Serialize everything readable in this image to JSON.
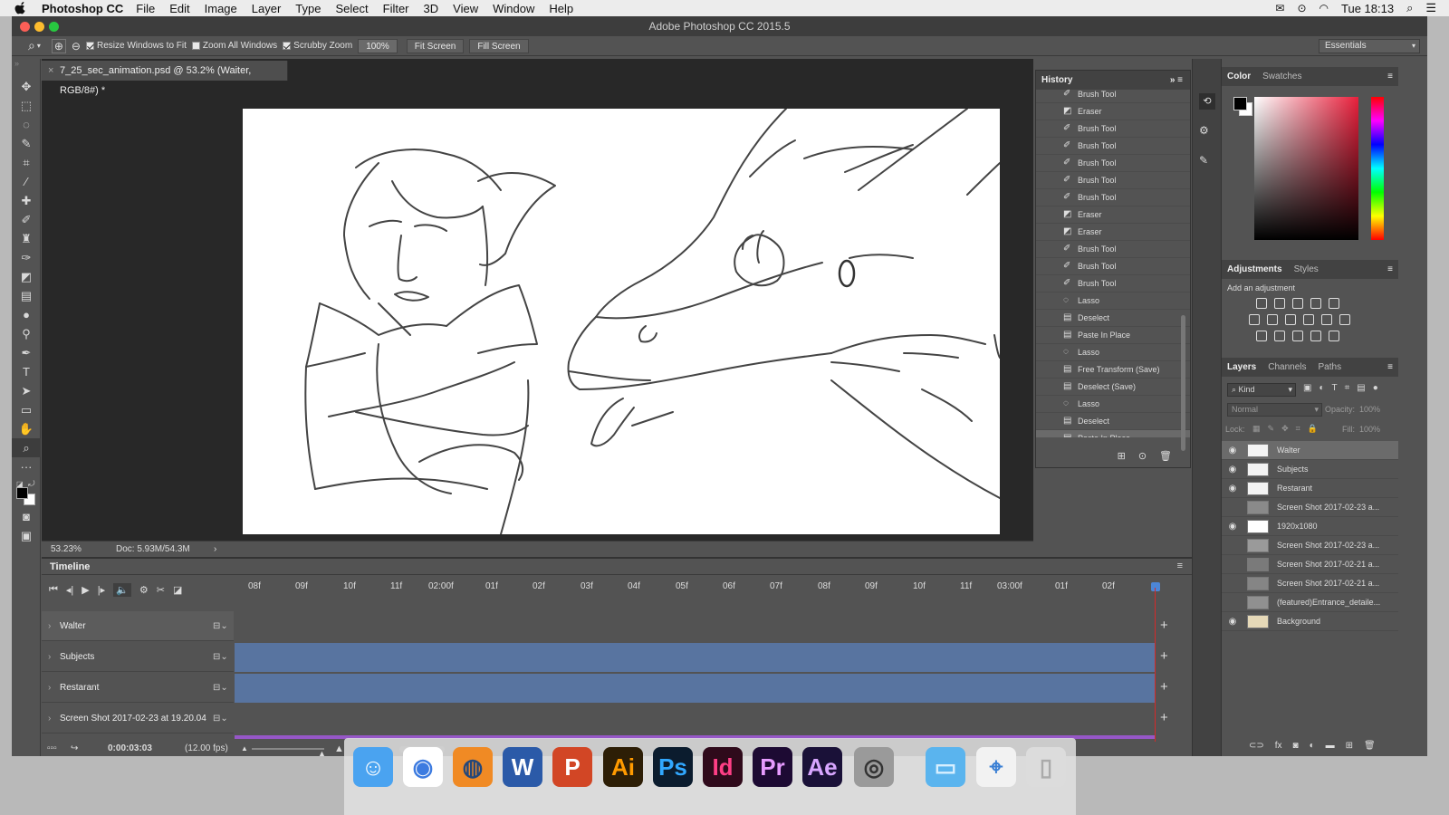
{
  "menubar": {
    "app_name": "Photoshop CC",
    "items": [
      "File",
      "Edit",
      "Image",
      "Layer",
      "Type",
      "Select",
      "Filter",
      "3D",
      "View",
      "Window",
      "Help"
    ],
    "clock": "Tue 18:13"
  },
  "window": {
    "title": "Adobe Photoshop CC 2015.5"
  },
  "options_bar": {
    "resize_windows": "Resize Windows to Fit",
    "zoom_all": "Zoom All Windows",
    "scrubby": "Scrubby Zoom",
    "zoom_value": "100%",
    "fit_screen": "Fit Screen",
    "fill_screen": "Fill Screen",
    "workspace": "Essentials"
  },
  "document": {
    "tab_title": "7_25_sec_animation.psd @ 53.2% (Waiter, RGB/8#) *",
    "zoom": "53.23%",
    "doc_size": "Doc: 5.93M/54.3M"
  },
  "history": {
    "title": "History",
    "items": [
      {
        "label": "Brush Tool",
        "icon": "brush-icon"
      },
      {
        "label": "Eraser",
        "icon": "eraser-icon"
      },
      {
        "label": "Brush Tool",
        "icon": "brush-icon"
      },
      {
        "label": "Brush Tool",
        "icon": "brush-icon"
      },
      {
        "label": "Brush Tool",
        "icon": "brush-icon"
      },
      {
        "label": "Brush Tool",
        "icon": "brush-icon"
      },
      {
        "label": "Brush Tool",
        "icon": "brush-icon"
      },
      {
        "label": "Eraser",
        "icon": "eraser-icon"
      },
      {
        "label": "Eraser",
        "icon": "eraser-icon"
      },
      {
        "label": "Brush Tool",
        "icon": "brush-icon"
      },
      {
        "label": "Brush Tool",
        "icon": "brush-icon"
      },
      {
        "label": "Brush Tool",
        "icon": "brush-icon"
      },
      {
        "label": "Lasso",
        "icon": "lasso-icon"
      },
      {
        "label": "Deselect",
        "icon": "doc-icon"
      },
      {
        "label": "Paste In Place",
        "icon": "doc-icon"
      },
      {
        "label": "Lasso",
        "icon": "lasso-icon"
      },
      {
        "label": "Free Transform (Save)",
        "icon": "doc-icon"
      },
      {
        "label": "Deselect (Save)",
        "icon": "doc-icon"
      },
      {
        "label": "Lasso",
        "icon": "lasso-icon"
      },
      {
        "label": "Deselect",
        "icon": "doc-icon"
      },
      {
        "label": "Paste In Place",
        "icon": "doc-icon"
      }
    ]
  },
  "color_panel": {
    "tabs": [
      "Color",
      "Swatches"
    ]
  },
  "adjustments_panel": {
    "tabs": [
      "Adjustments",
      "Styles"
    ],
    "hint": "Add an adjustment"
  },
  "layers_panel": {
    "tabs": [
      "Layers",
      "Channels",
      "Paths"
    ],
    "kind": "Kind",
    "blend": "Normal",
    "opacity_label": "Opacity:",
    "opacity": "100%",
    "lock_label": "Lock:",
    "fill_label": "Fill:",
    "fill": "100%",
    "layers": [
      {
        "name": "Walter",
        "visible": true,
        "selected": true,
        "thumb": "#f3f3f3"
      },
      {
        "name": "Subjects",
        "visible": true,
        "selected": false,
        "thumb": "#f3f3f3"
      },
      {
        "name": "Restarant",
        "visible": true,
        "selected": false,
        "thumb": "#f3f3f3"
      },
      {
        "name": "Screen Shot 2017-02-23 a...",
        "visible": false,
        "selected": false,
        "thumb": "#8a8a8a"
      },
      {
        "name": "1920x1080",
        "visible": true,
        "selected": false,
        "thumb": "#ffffff"
      },
      {
        "name": "Screen Shot 2017-02-23 a...",
        "visible": false,
        "selected": false,
        "thumb": "#9a9a9a"
      },
      {
        "name": "Screen Shot 2017-02-21 a...",
        "visible": false,
        "selected": false,
        "thumb": "#7a7a7a"
      },
      {
        "name": "Screen Shot 2017-02-21 a...",
        "visible": false,
        "selected": false,
        "thumb": "#858585"
      },
      {
        "name": "(featured)Entrance_detaile...",
        "visible": false,
        "selected": false,
        "thumb": "#909090"
      },
      {
        "name": "Background",
        "visible": true,
        "selected": false,
        "thumb": "#e6d9b8"
      }
    ]
  },
  "timeline": {
    "title": "Timeline",
    "ruler": [
      "08f",
      "09f",
      "10f",
      "11f",
      "02:00f",
      "01f",
      "02f",
      "03f",
      "04f",
      "05f",
      "06f",
      "07f",
      "08f",
      "09f",
      "10f",
      "11f",
      "03:00f",
      "01f",
      "02f"
    ],
    "tracks": [
      {
        "name": "Walter",
        "bar_color": "#535353"
      },
      {
        "name": "Subjects",
        "bar_color": "#5874a0"
      },
      {
        "name": "Restarant",
        "bar_color": "#5874a0"
      },
      {
        "name": "Screen Shot 2017-02-23 at 19.20.04",
        "bar_color": "#535353"
      }
    ],
    "timecode": "0:00:03:03",
    "fps": "(12.00 fps)"
  },
  "dock": {
    "apps": [
      {
        "name": "finder",
        "glyph": "☺",
        "bg": "#4aa3f0",
        "fg": "#ffffff"
      },
      {
        "name": "chrome",
        "glyph": "◉",
        "bg": "#ffffff",
        "fg": "#3c7be0"
      },
      {
        "name": "firefox",
        "glyph": "◍",
        "bg": "#f08a24",
        "fg": "#24477a"
      },
      {
        "name": "word",
        "glyph": "W",
        "bg": "#2b5aa8",
        "fg": "#ffffff"
      },
      {
        "name": "powerpoint",
        "glyph": "P",
        "bg": "#d24625",
        "fg": "#ffffff"
      },
      {
        "name": "illustrator",
        "glyph": "Ai",
        "bg": "#2d1e06",
        "fg": "#ff9a00"
      },
      {
        "name": "photoshop",
        "glyph": "Ps",
        "bg": "#0b1c2e",
        "fg": "#31a8ff"
      },
      {
        "name": "indesign",
        "glyph": "Id",
        "bg": "#2f0a1b",
        "fg": "#ff3f86"
      },
      {
        "name": "premiere",
        "glyph": "Pr",
        "bg": "#1d0a33",
        "fg": "#e79bff"
      },
      {
        "name": "after-effects",
        "glyph": "Ae",
        "bg": "#1a1138",
        "fg": "#d8a6ff"
      },
      {
        "name": "screenshot",
        "glyph": "◎",
        "bg": "#9a9a9a",
        "fg": "#333333"
      },
      {
        "name": "folder",
        "glyph": "▭",
        "bg": "#5ab4ee",
        "fg": "#d7efff"
      },
      {
        "name": "webloc",
        "glyph": "⌖",
        "bg": "#f2f2f2",
        "fg": "#3a7fd4"
      },
      {
        "name": "trash",
        "glyph": "▯",
        "bg": "#dcdcdc",
        "fg": "#aaaaaa"
      }
    ]
  }
}
